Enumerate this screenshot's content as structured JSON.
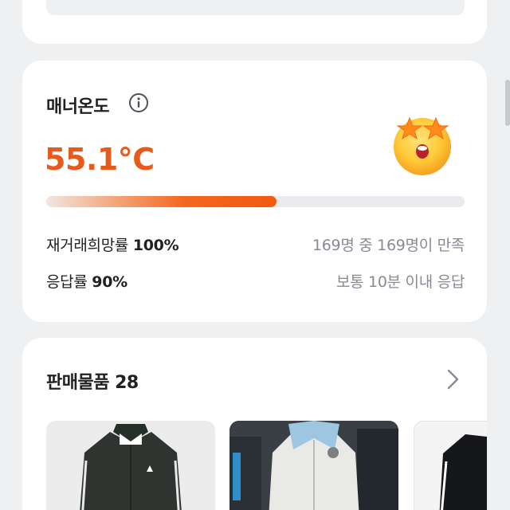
{
  "manner": {
    "title": "매너온도",
    "temperature": "55.1°C",
    "temperature_fraction": 0.551,
    "rehire_label": "재거래희망률",
    "rehire_value": "100%",
    "rehire_detail": "169명 중 169명이 만족",
    "response_label": "응답률",
    "response_value": "90%",
    "response_detail": "보통 10분 이내 응답",
    "accent_color": "#e85a1b"
  },
  "sales": {
    "title": "판매물품 28"
  },
  "icons": [
    "info-icon",
    "star-eyes-emoji-icon",
    "chevron-right-icon"
  ]
}
